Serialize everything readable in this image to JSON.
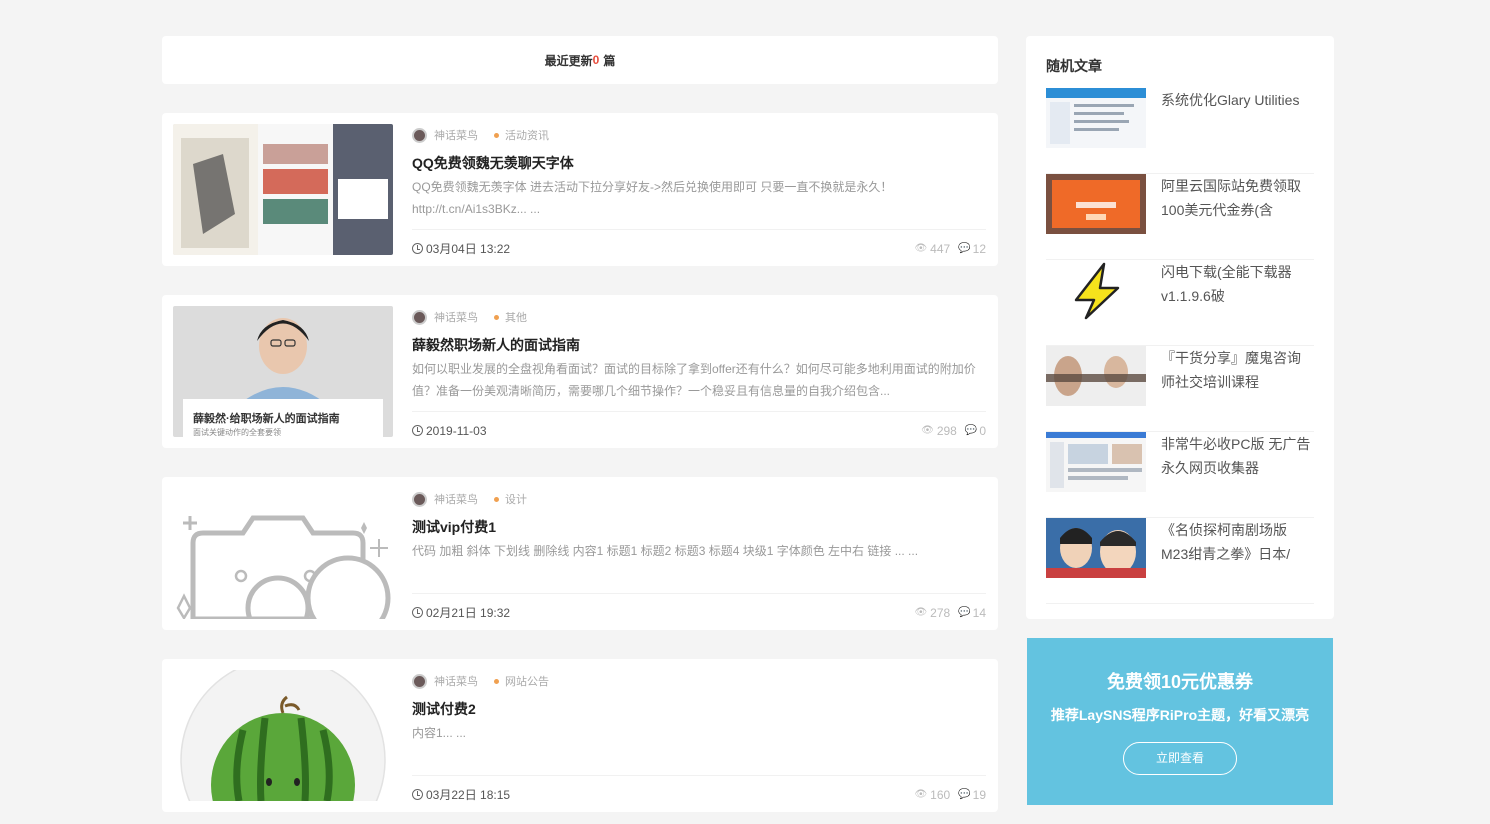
{
  "header": {
    "prefix": "最近更新",
    "count": "0",
    "suffix": "篇"
  },
  "posts": [
    {
      "author": "神话菜鸟",
      "category": "活动资讯",
      "title": "QQ免费领魏无羡聊天字体",
      "excerpt": "QQ免费领魏无羡字体 进去活动下拉分享好友->然后兑换使用即可 只要一直不换就是永久！http://t.cn/Ai1s3BKz... ...",
      "date": "03月04日 13:22",
      "views": "447",
      "comments": "12"
    },
    {
      "author": "神话菜鸟",
      "category": "其他",
      "title": "薛毅然职场新人的面试指南",
      "excerpt": "如何以职业发展的全盘视角看面试？面试的目标除了拿到offer还有什么？如何尽可能多地利用面试的附加价值？准备一份美观清晰简历，需要哪几个细节操作？一个稳妥且有信息量的自我介绍包含...",
      "date": "2019-11-03",
      "views": "298",
      "comments": "0",
      "thumb_title": "薛毅然·给职场新人的面试指南",
      "thumb_sub": "面试关键动作的全套要领"
    },
    {
      "author": "神话菜鸟",
      "category": "设计",
      "title": "测试vip付费1",
      "excerpt": "代码 加粗 斜体 下划线 删除线 内容1 标题1 标题2 标题3 标题4 块级1 字体颜色 左中右 链接 ... ...",
      "date": "02月21日 19:32",
      "views": "278",
      "comments": "14"
    },
    {
      "author": "神话菜鸟",
      "category": "网站公告",
      "title": "测试付费2",
      "excerpt": "内容1... ...",
      "date": "03月22日 18:15",
      "views": "160",
      "comments": "19"
    }
  ],
  "sidebar": {
    "title": "随机文章",
    "items": [
      {
        "text": "系统优化Glary Utilities"
      },
      {
        "text": "阿里云国际站免费领取100美元代金券(含"
      },
      {
        "text": "闪电下载(全能下载器v1.1.9.6破"
      },
      {
        "text": "『干货分享』魔鬼咨询师社交培训课程"
      },
      {
        "text": "非常牛必收PC版 无广告永久网页收集器"
      },
      {
        "text": "《名侦探柯南剧场版M23绀青之拳》日本/"
      }
    ],
    "promo_title": "免费领10元优惠券",
    "promo_sub": "推荐LaySNS程序RiPro主题，好看又漂亮",
    "promo_button": "立即查看"
  },
  "colors": {
    "accent": "#63c3e0",
    "count_red": "#e74c3c",
    "category_dot": "#f0a050"
  }
}
